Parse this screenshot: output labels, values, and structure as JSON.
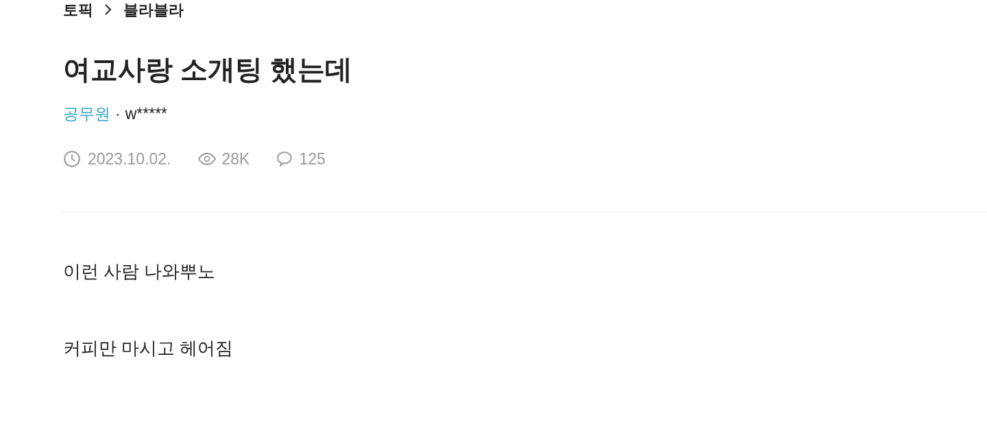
{
  "breadcrumb": [
    "토픽",
    "블라블라"
  ],
  "title": "여교사랑 소개팅 했는데",
  "author": {
    "company": "공무원",
    "separator": "·",
    "name": "w*****"
  },
  "stats": {
    "date": "2023.10.02.",
    "views": "28K",
    "comments": "125"
  },
  "body": [
    "이런 사람 나와뿌노",
    "커피만 마시고 헤어짐"
  ]
}
